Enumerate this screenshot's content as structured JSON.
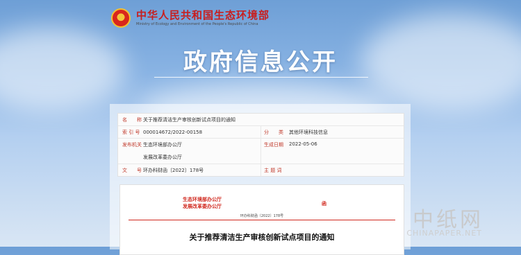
{
  "header": {
    "ministry_cn": "中华人民共和国生态环境部",
    "ministry_en": "Ministry of Ecology and Environment of the People's Republic of China",
    "emblem_icon": "national-emblem-icon"
  },
  "page_title": "政府信息公开",
  "info": {
    "name_label": "名　　称",
    "name_value": "关于推荐清洁生产审核创新试点项目的通知",
    "index_label": "索 引 号",
    "index_value": "000014672/2022-00158",
    "category_label": "分　　类",
    "category_value": "其他环境科技信息",
    "issuer_label": "发布机关",
    "issuer_values": [
      "生态环境部办公厅",
      "发展改革委办公厅"
    ],
    "date_label": "生成日期",
    "date_value": "2022-05-06",
    "docno_label": "文　　号",
    "docno_value": "环办科财函〔2022〕178号",
    "subject_label": "主 题 词",
    "subject_value": ""
  },
  "document": {
    "issuers": [
      "生态环境部办公厅",
      "发展改革委办公厅"
    ],
    "han": "函",
    "doc_number": "环办科财函〔2022〕178号",
    "title": "关于推荐清洁生产审核创新试点项目的通知"
  },
  "watermark": {
    "cn": "中纸网",
    "en": "CHINAPAPER.NET"
  },
  "colors": {
    "accent_red": "#c81e1e",
    "label_red": "#c0392b"
  }
}
